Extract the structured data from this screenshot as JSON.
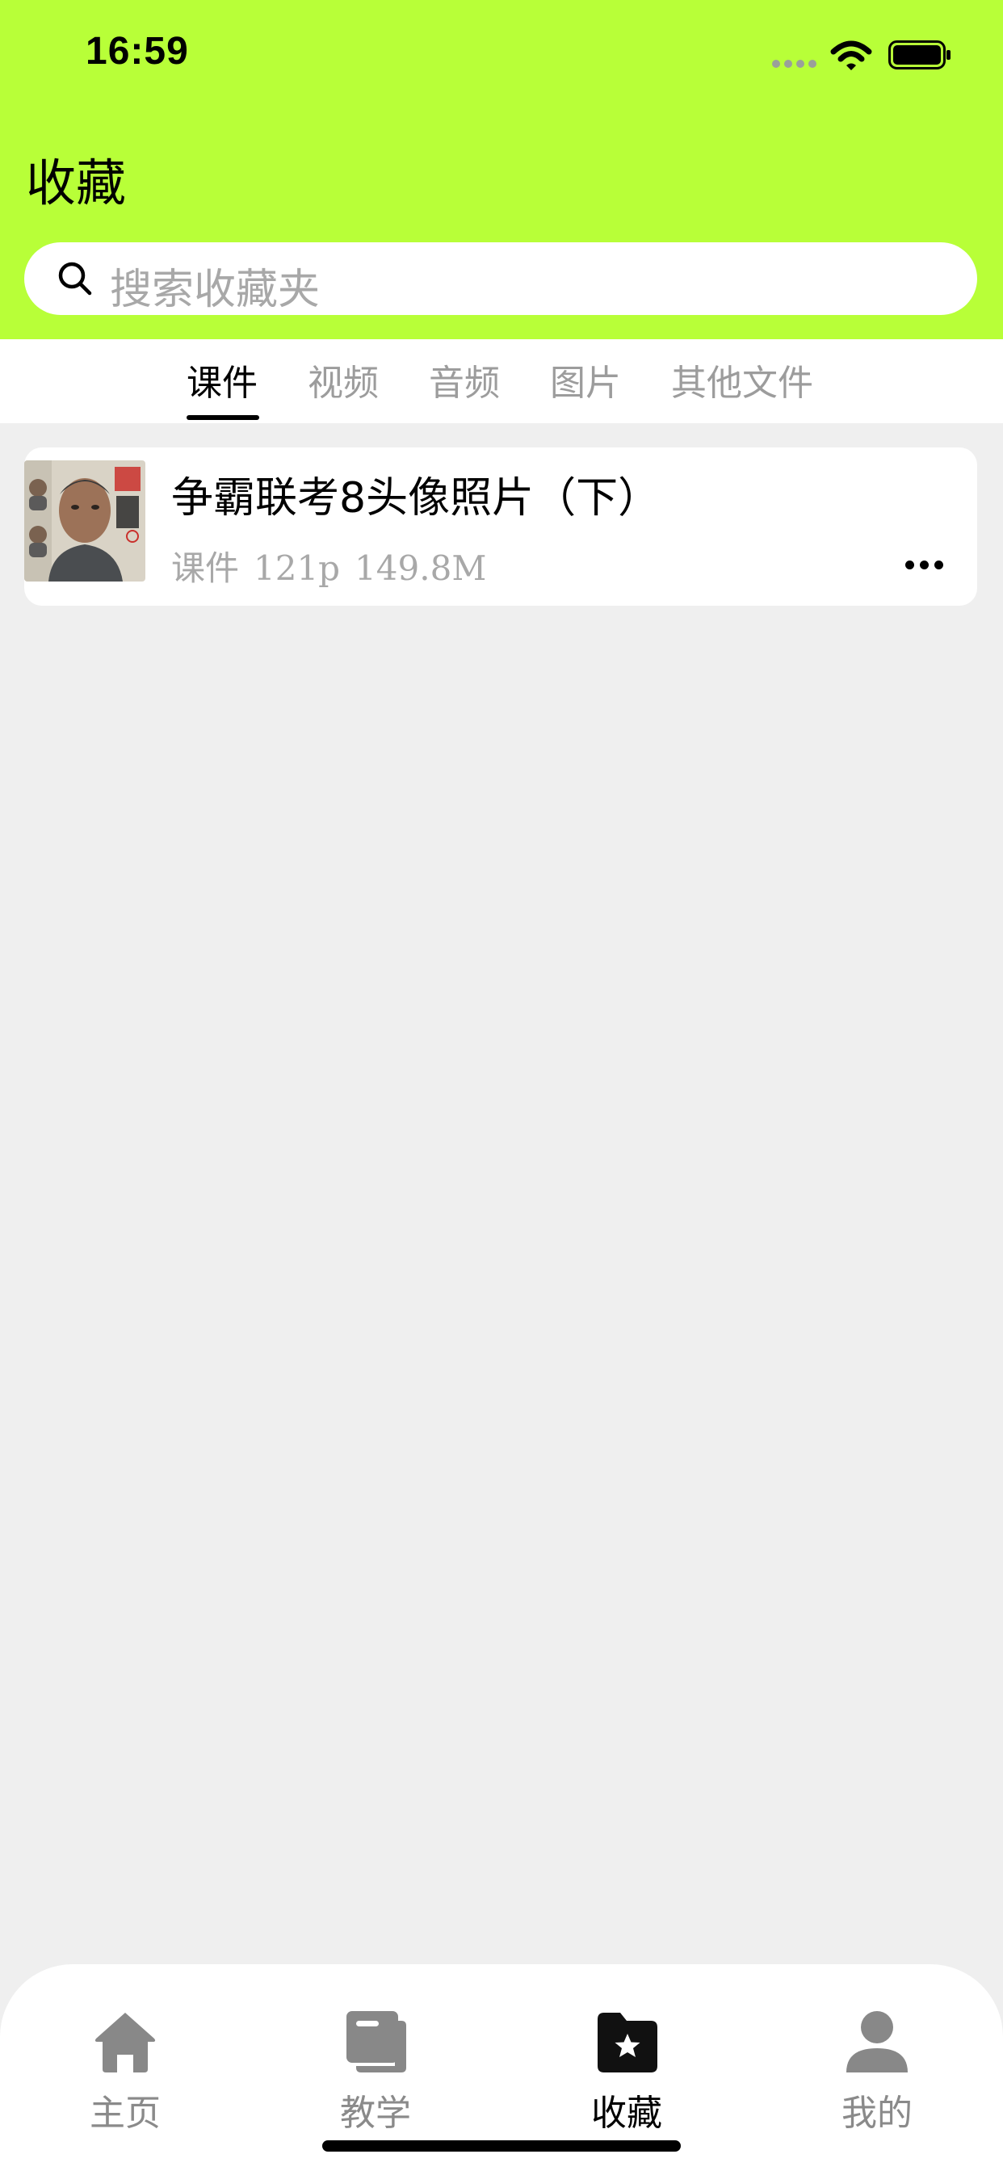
{
  "status_bar": {
    "time": "16:59",
    "signal_icon": "signal-dots-icon",
    "wifi_icon": "wifi-icon",
    "battery_icon": "battery-icon"
  },
  "header": {
    "title": "收藏",
    "background_color": "#b8ff38"
  },
  "search": {
    "placeholder": "搜索收藏夹",
    "icon": "search-icon"
  },
  "tabs": [
    {
      "label": "课件",
      "active": true
    },
    {
      "label": "视频",
      "active": false
    },
    {
      "label": "音频",
      "active": false
    },
    {
      "label": "图片",
      "active": false
    },
    {
      "label": "其他文件",
      "active": false
    }
  ],
  "items": [
    {
      "title": "争霸联考8头像照片（下）",
      "type": "课件",
      "pages": "121p",
      "size": "149.8M",
      "thumbnail_icon": "courseware-thumbnail",
      "more_icon": "more-icon"
    }
  ],
  "bottom_nav": [
    {
      "label": "主页",
      "icon": "home-icon",
      "active": false
    },
    {
      "label": "教学",
      "icon": "teaching-icon",
      "active": false
    },
    {
      "label": "收藏",
      "icon": "favorites-folder-icon",
      "active": true
    },
    {
      "label": "我的",
      "icon": "profile-icon",
      "active": false
    }
  ]
}
